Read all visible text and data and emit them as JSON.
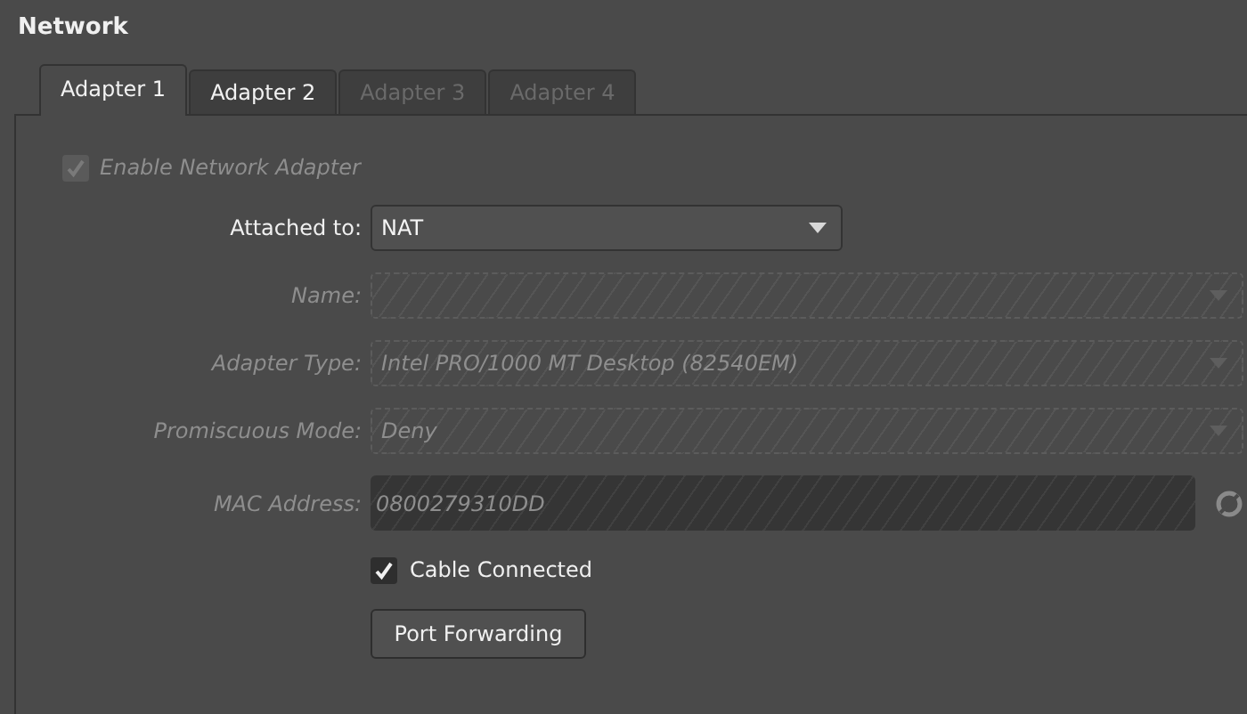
{
  "section_title": "Network",
  "tabs": [
    {
      "label": "Adapter 1",
      "selected": true,
      "disabled": false
    },
    {
      "label": "Adapter 2",
      "selected": false,
      "disabled": false
    },
    {
      "label": "Adapter 3",
      "selected": false,
      "disabled": true
    },
    {
      "label": "Adapter 4",
      "selected": false,
      "disabled": true
    }
  ],
  "enable_adapter": {
    "label": "Enable Network Adapter",
    "checked": true,
    "disabled": true
  },
  "fields": [
    {
      "kind": "dropdown",
      "label": "Attached to:",
      "value": "NAT",
      "disabled": false
    },
    {
      "kind": "dropdown",
      "label": "Name:",
      "disabled": true
    },
    {
      "kind": "dropdown",
      "label": "Adapter Type:",
      "value": "Intel PRO/1000 MT Desktop (82540EM)",
      "disabled": true
    },
    {
      "kind": "dropdown",
      "label": "Promiscuous Mode:",
      "value": "Deny",
      "disabled": true
    },
    {
      "kind": "text",
      "label": "MAC Address:",
      "value": "0800279310DD",
      "disabled": true
    }
  ],
  "cable_connected": {
    "label": "Cable Connected",
    "checked": true,
    "disabled": false
  },
  "port_forwarding_button": {
    "label": "Port Forwarding",
    "disabled": false
  }
}
